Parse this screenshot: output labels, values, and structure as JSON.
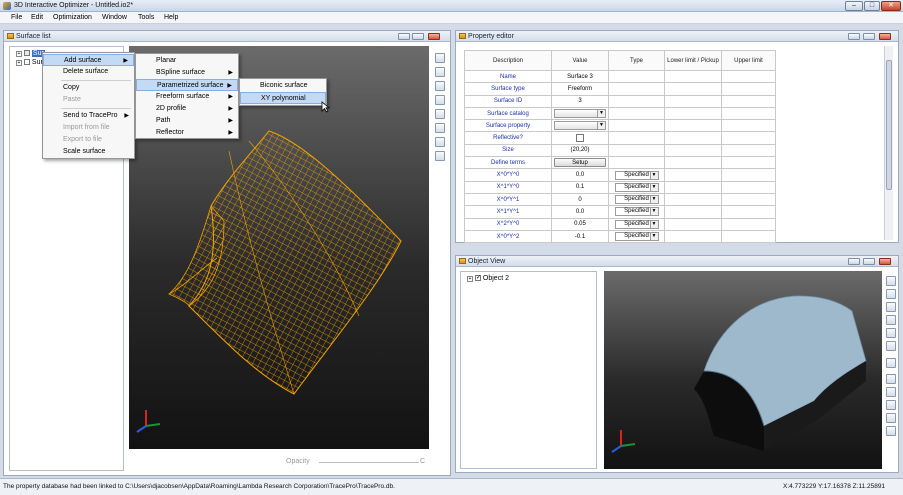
{
  "window": {
    "title": "3D Interactive Optimizer - Untitled.io2*",
    "controls": {
      "minimize": "–",
      "maximize": "□",
      "close": "✕"
    }
  },
  "menu": [
    "File",
    "Edit",
    "Optimization",
    "Window",
    "Tools",
    "Help"
  ],
  "surface_list": {
    "title": "Surface list",
    "tree": [
      {
        "label": "Sur"
      },
      {
        "label": "Sur"
      }
    ],
    "opacity_label": "Opacity",
    "opacity_end": "C"
  },
  "context_menu": {
    "items": [
      {
        "label": "Add surface",
        "submenu": true,
        "selected": true,
        "disabled": false
      },
      {
        "label": "Delete surface",
        "submenu": false,
        "selected": false,
        "disabled": false
      },
      {
        "label": "Copy",
        "submenu": false,
        "selected": false,
        "disabled": false
      },
      {
        "label": "Paste",
        "submenu": false,
        "selected": false,
        "disabled": true
      },
      {
        "label": "Send to TracePro",
        "submenu": true,
        "selected": false,
        "disabled": false
      },
      {
        "label": "Import from file",
        "submenu": false,
        "selected": false,
        "disabled": true
      },
      {
        "label": "Export to file",
        "submenu": false,
        "selected": false,
        "disabled": true
      },
      {
        "label": "Scale surface",
        "submenu": false,
        "selected": false,
        "disabled": false
      }
    ]
  },
  "add_surface_menu": {
    "items": [
      {
        "label": "Planar",
        "submenu": false,
        "selected": false
      },
      {
        "label": "BSpline surface",
        "submenu": true,
        "selected": false
      },
      {
        "label": "Parametrized surface",
        "submenu": true,
        "selected": true
      },
      {
        "label": "Freeform surface",
        "submenu": true,
        "selected": false
      },
      {
        "label": "2D profile",
        "submenu": true,
        "selected": false
      },
      {
        "label": "Path",
        "submenu": true,
        "selected": false
      },
      {
        "label": "Reflector",
        "submenu": true,
        "selected": false
      }
    ]
  },
  "parametrized_menu": {
    "items": [
      {
        "label": "Biconic surface",
        "selected": false
      },
      {
        "label": "XY polynomial",
        "selected": true
      }
    ]
  },
  "property_editor": {
    "title": "Property editor",
    "columns": [
      "Description",
      "Value",
      "Type",
      "Lower limit / Pickup",
      "Upper limit"
    ],
    "rows": [
      {
        "desc": "Name",
        "value": "Surface 3",
        "kind": "text"
      },
      {
        "desc": "Surface type",
        "value": "Freeform",
        "kind": "text"
      },
      {
        "desc": "Surface ID",
        "value": "3",
        "kind": "text"
      },
      {
        "desc": "Surface catalog",
        "value": "",
        "kind": "dropdown"
      },
      {
        "desc": "Surface property",
        "value": "",
        "kind": "dropdown"
      },
      {
        "desc": "Reflective?",
        "value": "",
        "kind": "checkbox"
      },
      {
        "desc": "Size",
        "value": "(20,20)",
        "kind": "text"
      },
      {
        "desc": "Define terms",
        "value": "Setup",
        "kind": "button"
      },
      {
        "desc": "X^0*Y^0",
        "value": "0.0",
        "type": "Specified",
        "kind": "term"
      },
      {
        "desc": "X^1*Y^0",
        "value": "0.1",
        "type": "Specified",
        "kind": "term"
      },
      {
        "desc": "X^0*Y^1",
        "value": "0",
        "type": "Specified",
        "kind": "term"
      },
      {
        "desc": "X^1*Y^1",
        "value": "0.0",
        "type": "Specified",
        "kind": "term"
      },
      {
        "desc": "X^2*Y^0",
        "value": "0.05",
        "type": "Specified",
        "kind": "term"
      },
      {
        "desc": "X^0*Y^2",
        "value": "-0.1",
        "type": "Specified",
        "kind": "term"
      }
    ]
  },
  "object_view": {
    "title": "Object View",
    "tree": [
      {
        "label": "Object 2",
        "checked": true
      }
    ]
  },
  "statusbar": {
    "message": "The property database had been linked to C:\\Users\\djacobsen\\AppData\\Roaming\\Lambda Research Corporation\\TracePro\\TracePro.db.",
    "coords": "X:4.773229 Y:17.16378 Z:11.25891"
  },
  "colors": {
    "wireframe": "#f5a300",
    "solid": "#9fb9cc",
    "selection": "#c3daf5"
  }
}
